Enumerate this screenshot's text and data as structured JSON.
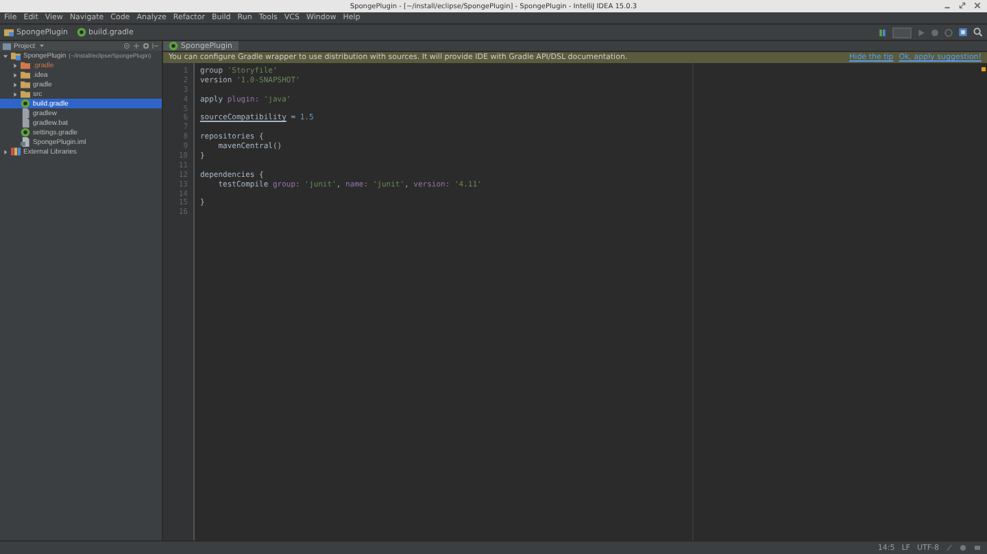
{
  "window": {
    "title": "SpongePlugin - [~/install/eclipse/SpongePlugin] - SpongePlugin - IntelliJ IDEA 15.0.3"
  },
  "menu": [
    "File",
    "Edit",
    "View",
    "Navigate",
    "Code",
    "Analyze",
    "Refactor",
    "Build",
    "Run",
    "Tools",
    "VCS",
    "Window",
    "Help"
  ],
  "nav": [
    {
      "label": "SpongePlugin",
      "kind": "project"
    },
    {
      "label": "build.gradle",
      "kind": "gradle"
    }
  ],
  "project_panel": {
    "title": "Project",
    "tree": [
      {
        "label": "SpongePlugin",
        "path": "(~/install/eclipse/SpongePlugin)",
        "kind": "module",
        "expanded": true,
        "selected": false,
        "children": [
          {
            "label": ".gradle",
            "kind": "excluded-folder",
            "expanded": false,
            "selected": false
          },
          {
            "label": ".idea",
            "kind": "folder",
            "expanded": false,
            "selected": false
          },
          {
            "label": "gradle",
            "kind": "folder",
            "expanded": false,
            "selected": false
          },
          {
            "label": "src",
            "kind": "folder",
            "expanded": false,
            "selected": false
          },
          {
            "label": "build.gradle",
            "kind": "gradle",
            "selected": true
          },
          {
            "label": "gradlew",
            "kind": "file",
            "selected": false
          },
          {
            "label": "gradlew.bat",
            "kind": "file",
            "selected": false
          },
          {
            "label": "settings.gradle",
            "kind": "gradle",
            "selected": false
          },
          {
            "label": "SpongePlugin.iml",
            "kind": "iml",
            "selected": false
          }
        ]
      },
      {
        "label": "External Libraries",
        "kind": "library",
        "expanded": false,
        "selected": false
      }
    ]
  },
  "editor": {
    "tabs": [
      {
        "label": "SpongePlugin",
        "selected": true
      }
    ],
    "banner": {
      "text": "You can configure Gradle wrapper to use distribution with sources. It will provide IDE with Gradle API/DSL documentation.",
      "links": [
        "Hide the tip",
        "Ok, apply suggestion!"
      ]
    },
    "lines": [
      {
        "number": "1",
        "tokens": [
          {
            "text": "group ",
            "kind": "plain"
          },
          {
            "text": "'Storyfile'",
            "kind": "string"
          }
        ]
      },
      {
        "number": "2",
        "tokens": [
          {
            "text": "version ",
            "kind": "plain"
          },
          {
            "text": "'1.0-SNAPSHOT'",
            "kind": "string"
          }
        ]
      },
      {
        "number": "3"
      },
      {
        "number": "4",
        "tokens": [
          {
            "text": "apply ",
            "kind": "plain"
          },
          {
            "text": "plugin: ",
            "kind": "named"
          },
          {
            "text": "'java'",
            "kind": "string"
          }
        ]
      },
      {
        "number": "5"
      },
      {
        "number": "6",
        "tokens": [
          {
            "text": "sourceCompatibility",
            "kind": "underlined"
          },
          {
            "text": " = ",
            "kind": "plain"
          },
          {
            "text": "1.5",
            "kind": "number"
          }
        ]
      },
      {
        "number": "7"
      },
      {
        "number": "8",
        "tokens": [
          {
            "text": "repositories {",
            "kind": "plain"
          }
        ]
      },
      {
        "number": "9",
        "tokens": [
          {
            "text": "    mavenCentral()",
            "kind": "plain"
          }
        ]
      },
      {
        "number": "10",
        "tokens": [
          {
            "text": "}",
            "kind": "plain"
          }
        ]
      },
      {
        "number": "11"
      },
      {
        "number": "12",
        "tokens": [
          {
            "text": "dependencies {",
            "kind": "plain"
          }
        ]
      },
      {
        "number": "13",
        "tokens": [
          {
            "text": "    testCompile ",
            "kind": "plain"
          },
          {
            "text": "group: ",
            "kind": "named"
          },
          {
            "text": "'junit'",
            "kind": "string"
          },
          {
            "text": ", ",
            "kind": "plain"
          },
          {
            "text": "name: ",
            "kind": "named"
          },
          {
            "text": "'junit'",
            "kind": "string"
          },
          {
            "text": ", ",
            "kind": "plain"
          },
          {
            "text": "version: ",
            "kind": "named"
          },
          {
            "text": "'4.11'",
            "kind": "string"
          }
        ]
      },
      {
        "number": "14"
      },
      {
        "number": "15",
        "tokens": [
          {
            "text": "}",
            "kind": "plain"
          }
        ]
      },
      {
        "number": "16"
      }
    ]
  },
  "status_bar": {
    "items": [
      "14:5",
      "LF",
      "UTF-8"
    ]
  }
}
